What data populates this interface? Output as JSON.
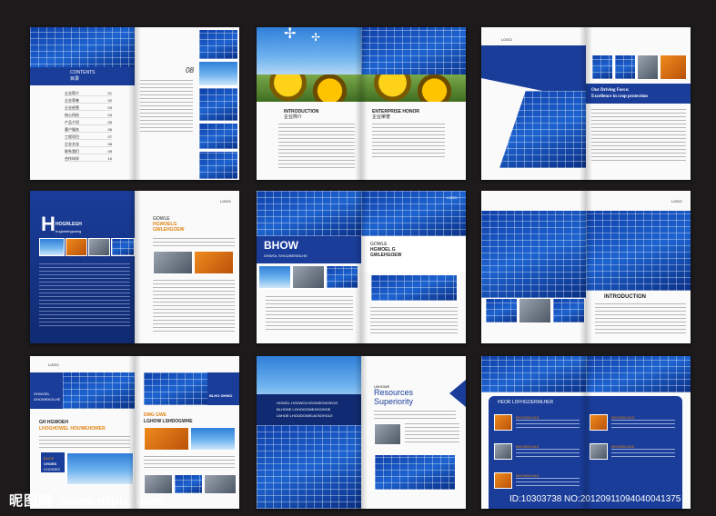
{
  "spread1": {
    "contents_label": "CONTENTS",
    "contents_cn": "目录",
    "page_num": "08",
    "toc": [
      "企业简介",
      "企业荣誉",
      "企业经营",
      "核心科技",
      "产品介绍",
      "客户服务",
      "工程项目",
      "企业文化",
      "联系我们",
      "合作伙伴"
    ],
    "toc_nums": [
      "01",
      "02",
      "03",
      "04",
      "05",
      "06",
      "07",
      "08",
      "09",
      "10"
    ]
  },
  "spread2": {
    "intro_title": "INTRODUCTION",
    "intro_cn": "企业简介",
    "honor_title": "ENTERPRISE HONOR",
    "honor_cn": "企业荣誉"
  },
  "spread3": {
    "logo": "LOGO",
    "headline": "Our Driving Force:",
    "headline2": "Excellence in crop protection"
  },
  "spread4": {
    "logo": "LOGO",
    "big_letter": "H",
    "title1": "HOGRLEGH",
    "title2": "hoghelehgoweg",
    "right_title1": "GOWLE",
    "right_title2": "HGWOELG",
    "right_title3": "GWLEHGOEW"
  },
  "spread5": {
    "logo": "LOGO",
    "big_title": "BHOW",
    "sub_title": "GHWOL SHOUWENGLHE",
    "right_title1": "GOWLE",
    "right_title2": "HGWOEL G",
    "right_title3": "GWLEHGOEW"
  },
  "spread6": {
    "logo": "LOGO",
    "intro_title": "INTRODUCTION"
  },
  "spread7": {
    "logo": "LOGO",
    "left_label1": "GHWOEL",
    "left_label2": "GHOWENGLHE",
    "left_head1": "GH HGWOEH",
    "left_head2": "LHOGHOWEL HOUWEHOWER",
    "box_text1": "BHOE",
    "box_text2": "CHOES",
    "box_text3": "CHOISES",
    "right_label": "BLHO GHWO",
    "right_head": "DMG GWE",
    "right_head2": "LGHOW LSHDOGWHE"
  },
  "spread8": {
    "logo": "LOGO",
    "left_line1": "HOWDL HGDWOLHGOWEGHOEOG",
    "left_line2": "BLHONE LGHOGOWEHGOHOE",
    "left_line3": "LBHOE LHGGDOWELM BOHOLE",
    "right_small": "LBHOWE",
    "right_title1": "Resources",
    "right_title2": "Superiority"
  },
  "spread9": {
    "header": "HEOR LDFHGOERMLHER",
    "label": "BHOWELMLE"
  },
  "footer": {
    "site_cn": "昵图网",
    "site_url": "www.nipic.com",
    "id_text": "ID:10303738 NO:20120911094040041375"
  }
}
